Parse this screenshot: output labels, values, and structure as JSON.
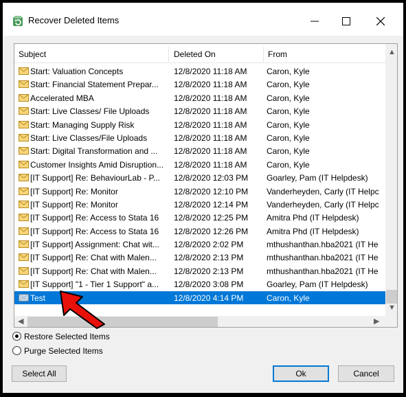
{
  "window": {
    "title": "Recover Deleted Items",
    "minimize_glyph": "—",
    "maximize_glyph": "☐",
    "close_glyph": "✕"
  },
  "columns": {
    "subject": "Subject",
    "deleted_on": "Deleted On",
    "from": "From"
  },
  "items": [
    {
      "subject": "Start: Valuation Concepts",
      "deleted_on": "12/8/2020 11:18 AM",
      "from": "Caron, Kyle"
    },
    {
      "subject": "Start: Financial Statement Prepar...",
      "deleted_on": "12/8/2020 11:18 AM",
      "from": "Caron, Kyle"
    },
    {
      "subject": "Accelerated MBA",
      "deleted_on": "12/8/2020 11:18 AM",
      "from": "Caron, Kyle"
    },
    {
      "subject": "Start: Live Classes/ File Uploads",
      "deleted_on": "12/8/2020 11:18 AM",
      "from": "Caron, Kyle"
    },
    {
      "subject": "Start: Managing Supply Risk",
      "deleted_on": "12/8/2020 11:18 AM",
      "from": "Caron, Kyle"
    },
    {
      "subject": "Start: Live Classes/File Uploads",
      "deleted_on": "12/8/2020 11:18 AM",
      "from": "Caron, Kyle"
    },
    {
      "subject": "Start: Digital Transformation and ...",
      "deleted_on": "12/8/2020 11:18 AM",
      "from": "Caron, Kyle"
    },
    {
      "subject": "Customer Insights Amid Disruption...",
      "deleted_on": "12/8/2020 11:18 AM",
      "from": "Caron, Kyle"
    },
    {
      "subject": "[IT Support] Re: BehaviourLab - P...",
      "deleted_on": "12/8/2020 12:03 PM",
      "from": "Goarley, Pam (IT Helpdesk)"
    },
    {
      "subject": "[IT Support] Re: Monitor",
      "deleted_on": "12/8/2020 12:10 PM",
      "from": "Vanderheyden, Carly (IT Helpc"
    },
    {
      "subject": "[IT Support] Re: Monitor",
      "deleted_on": "12/8/2020 12:14 PM",
      "from": "Vanderheyden, Carly (IT Helpc"
    },
    {
      "subject": "[IT Support] Re: Access to Stata 16",
      "deleted_on": "12/8/2020 12:25 PM",
      "from": "Amitra Phd (IT Helpdesk)"
    },
    {
      "subject": "[IT Support] Re: Access to Stata 16",
      "deleted_on": "12/8/2020 12:26 PM",
      "from": "Amitra Phd (IT Helpdesk)"
    },
    {
      "subject": "[IT Support] Assignment: Chat wit...",
      "deleted_on": "12/8/2020 2:02 PM",
      "from": "mthushanthan.hba2021 (IT He"
    },
    {
      "subject": "[IT Support] Re: Chat with Malen...",
      "deleted_on": "12/8/2020 2:13 PM",
      "from": "mthushanthan.hba2021 (IT He"
    },
    {
      "subject": "[IT Support] Re: Chat with Malen...",
      "deleted_on": "12/8/2020 2:13 PM",
      "from": "mthushanthan.hba2021 (IT He"
    },
    {
      "subject": "[IT Support] \"1 - Tier 1 Support\" a...",
      "deleted_on": "12/8/2020 3:08 PM",
      "from": "Goarley, Pam (IT Helpdesk)"
    },
    {
      "subject": "Test",
      "deleted_on": "12/8/2020 4:14 PM",
      "from": "Caron, Kyle",
      "selected": true
    }
  ],
  "options": {
    "restore_label": "Restore Selected Items",
    "purge_label": "Purge Selected Items",
    "selected": "restore"
  },
  "buttons": {
    "select_all": "Select All",
    "ok": "Ok",
    "cancel": "Cancel"
  },
  "colors": {
    "selection": "#0078d7",
    "annotation_arrow": "#e8100b"
  }
}
